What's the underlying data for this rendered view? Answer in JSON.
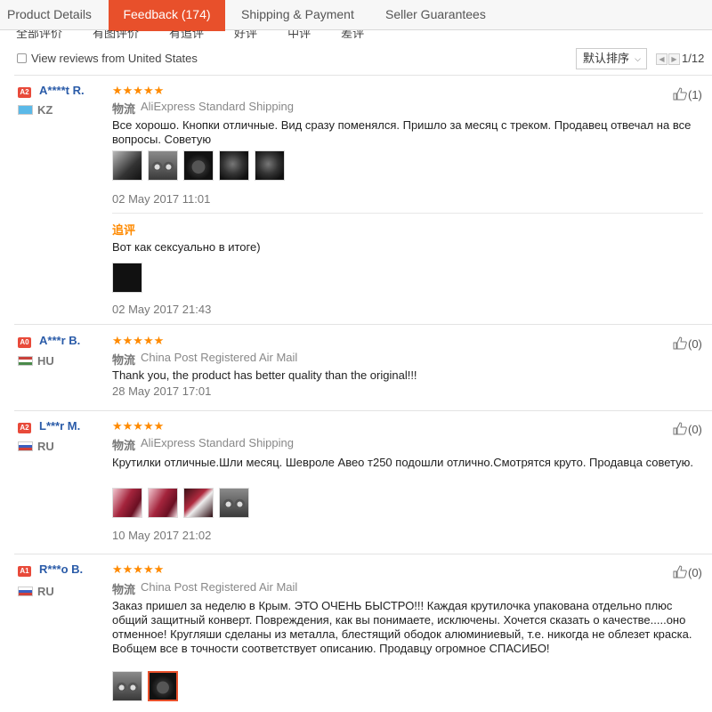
{
  "tabs": [
    {
      "label": "Product Details",
      "active": false
    },
    {
      "label": "Feedback (174)",
      "active": true
    },
    {
      "label": "Shipping & Payment",
      "active": false
    },
    {
      "label": "Seller Guarantees",
      "active": false
    }
  ],
  "toolbar": {
    "view_us_label": "View reviews from United States",
    "sort_label": "默认排序",
    "page": "1/12"
  },
  "colors": {
    "accent": "#e8502b",
    "stars": "#ff8a00",
    "name": "#2a5ba8",
    "level_badge": "#e84a3a"
  },
  "reviews": [
    {
      "level": "A2",
      "name": "A****t R.",
      "country": "KZ",
      "stars": "★★★★★",
      "rating": 5,
      "shipping_prefix": "物流",
      "shipping": "AliExpress Standard Shipping",
      "text": "Все хорошо. Кнопки отличные. Вид сразу поменялся. Пришло за месяц с треком. Продавец отвечал на все вопросы. Советую",
      "date": "02 May 2017 11:01",
      "helpful": "(1)",
      "followup": {
        "label": "追评",
        "text": "Вот как сексуально в итоге)",
        "date": "02 May 2017 21:43"
      }
    },
    {
      "level": "A0",
      "name": "A***r B.",
      "country": "HU",
      "stars": "★★★★★",
      "rating": 5,
      "shipping_prefix": "物流",
      "shipping": "China Post Registered Air Mail",
      "text": "Thank you, the product has better quality than the original!!!",
      "date": "28 May 2017 17:01",
      "helpful": "(0)"
    },
    {
      "level": "A2",
      "name": "L***r M.",
      "country": "RU",
      "stars": "★★★★★",
      "rating": 5,
      "shipping_prefix": "物流",
      "shipping": "AliExpress Standard Shipping",
      "text": "Крутилки отличные.Шли месяц. Шевроле Авео т250 подошли отлично.Смотрятся круто. Продавца советую.",
      "date": "10 May 2017 21:02",
      "helpful": "(0)"
    },
    {
      "level": "A1",
      "name": "R***o B.",
      "country": "RU",
      "stars": "★★★★★",
      "rating": 5,
      "shipping_prefix": "物流",
      "shipping": "China Post Registered Air Mail",
      "text": "Заказ пришел за неделю в Крым. ЭТО ОЧЕНЬ БЫСТРО!!! Каждая крутилочка упакована отдельно плюс общий защитный конверт. Повреждения, как вы понимаете, исключены. Хочется сказать о качестве.....оно отменное! Кругляши сделаны из металла, блестящий ободок алюминиевый, т.е. никогда не облезет краска. Вобщем все в точности соответствует описанию. Продавцу огромное СПАСИБО!",
      "helpful": "(0)"
    }
  ]
}
